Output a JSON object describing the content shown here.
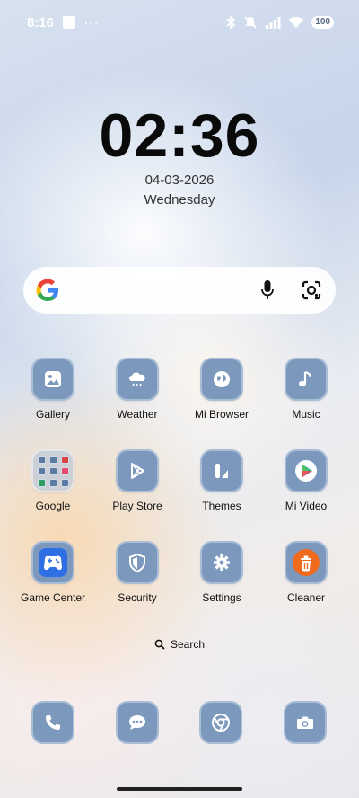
{
  "status_bar": {
    "time": "8:16",
    "dots": "···",
    "battery": "100"
  },
  "lock_clock": {
    "time": "02:36",
    "date": "04-03-2026",
    "weekday": "Wednesday"
  },
  "apps": [
    {
      "label": "Gallery",
      "icon": "gallery-icon"
    },
    {
      "label": "Weather",
      "icon": "weather-icon"
    },
    {
      "label": "Mi Browser",
      "icon": "browser-icon"
    },
    {
      "label": "Music",
      "icon": "music-icon"
    },
    {
      "label": "Google",
      "icon": "google-folder-icon"
    },
    {
      "label": "Play Store",
      "icon": "play-store-icon"
    },
    {
      "label": "Themes",
      "icon": "themes-icon"
    },
    {
      "label": "Mi Video",
      "icon": "mi-video-icon"
    },
    {
      "label": "Game Center",
      "icon": "game-center-icon"
    },
    {
      "label": "Security",
      "icon": "security-icon"
    },
    {
      "label": "Settings",
      "icon": "settings-icon"
    },
    {
      "label": "Cleaner",
      "icon": "cleaner-icon"
    }
  ],
  "home_search": {
    "label": "Search"
  },
  "dock": [
    "phone-icon",
    "messages-icon",
    "chrome-icon",
    "camera-icon"
  ],
  "colors": {
    "tile": "#7c98bd",
    "tile_border": "#a9bdd6",
    "cleaner": "#f06a1e"
  }
}
